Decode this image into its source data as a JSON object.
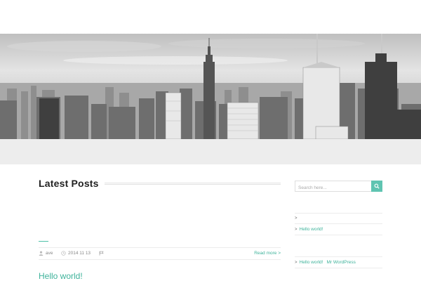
{
  "hero": {
    "alt": "city skyline"
  },
  "main": {
    "section_title": "Latest Posts",
    "post": {
      "author": "ave",
      "date": "2014 11 13",
      "read_more": "Read more >",
      "title": "Hello world!"
    }
  },
  "sidebar": {
    "search": {
      "placeholder": "Search here..."
    },
    "link_1": "Hello world!",
    "link_2_post": "Hello world!",
    "link_2_source": "Mr WordPress"
  },
  "colors": {
    "accent": "#3fb39b",
    "search_button": "#5fc4b1",
    "band": "#ededed"
  },
  "icons": {
    "author": "user-icon",
    "date": "clock-icon",
    "tag": "flag-icon",
    "search": "search-icon"
  }
}
